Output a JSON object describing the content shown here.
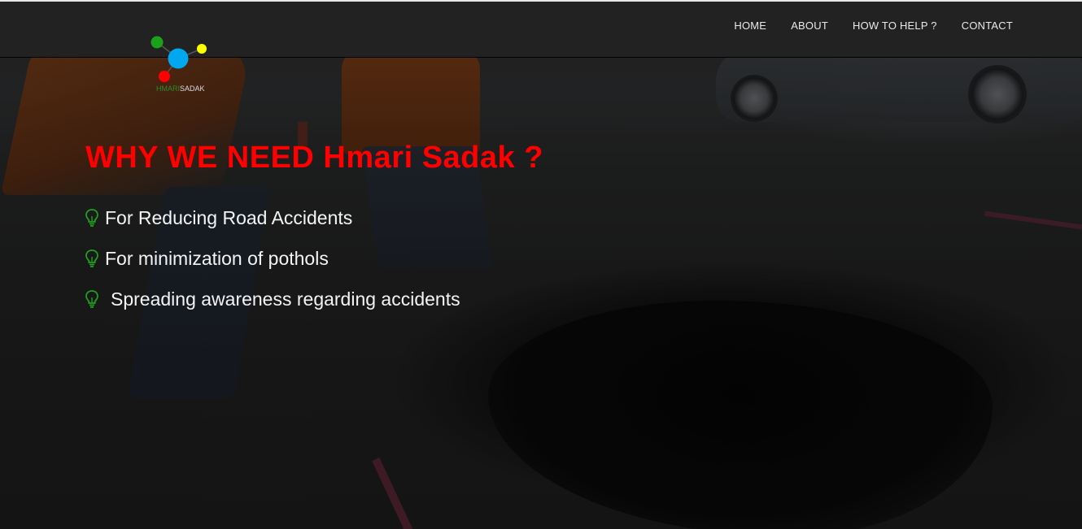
{
  "logo": {
    "text_part1": "HMARI",
    "text_part2": "SADAK",
    "colors": {
      "green": "#1aa31a",
      "blue": "#00a8f0",
      "yellow": "#ffff00",
      "red": "#ff0000"
    }
  },
  "nav": {
    "items": [
      {
        "label": "HOME"
      },
      {
        "label": "ABOUT"
      },
      {
        "label": "HOW TO HELP ?"
      },
      {
        "label": "CONTACT"
      }
    ]
  },
  "hero": {
    "title": "WHY WE NEED Hmari Sadak ?",
    "title_color": "#ff0000",
    "reasons": [
      {
        "icon": "lightbulb-icon",
        "text": "For Reducing Road Accidents"
      },
      {
        "icon": "lightbulb-icon",
        "text": "For minimization of pothols"
      },
      {
        "icon": "lightbulb-icon",
        "text": "Spreading awareness regarding accidents"
      }
    ],
    "icon_color": "#1fa01f"
  }
}
